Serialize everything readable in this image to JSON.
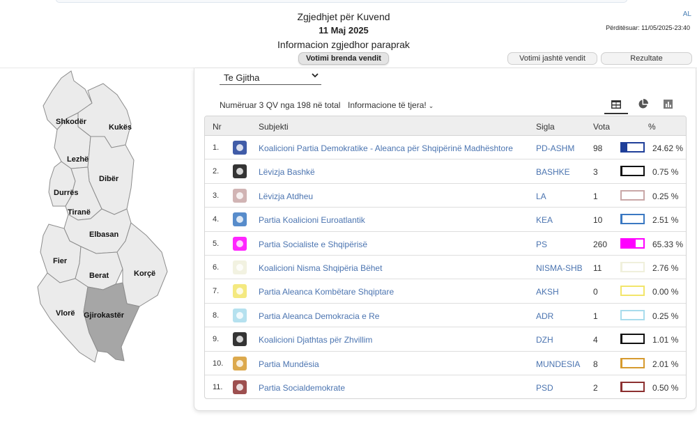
{
  "header": {
    "title": "Zgjedhjet për Kuvend",
    "date": "11 Maj 2025",
    "subtitle": "Informacion zgjedhor paraprak",
    "language": "AL",
    "updated": "Përditësuar: 11/05/2025-23:40"
  },
  "tabs": {
    "domestic": "Votimi brenda vendit",
    "abroad": "Votimi jashtë vendit",
    "results": "Rezultate"
  },
  "map": {
    "regions": [
      "Shkodër",
      "Kukës",
      "Lezhë",
      "Dibër",
      "Durrës",
      "Tiranë",
      "Elbasan",
      "Fier",
      "Berat",
      "Korçë",
      "Vlorë",
      "Gjirokastër"
    ],
    "selected": "Gjirokastër",
    "colors": {
      "default": "#ebebeb",
      "selected": "#a6a6a6",
      "border": "#8c8c8c"
    }
  },
  "filter": {
    "selected": "Te Gjitha"
  },
  "summary": {
    "counted": "Numëruar 3 QV nga 198 në total",
    "more_info": "Informacione të tjera!"
  },
  "views": [
    "table-icon",
    "pie-chart-icon",
    "bar-chart-icon"
  ],
  "table": {
    "headers": {
      "nr": "Nr",
      "subject": "Subjekti",
      "abbr": "Sigla",
      "votes": "Vota",
      "pct": "%"
    },
    "rows": [
      {
        "nr": "1.",
        "name": "Koalicioni Partia Demokratike - Aleanca për Shqipërinë Madhështore",
        "abbr": "PD-ASHM",
        "votes": "98",
        "pct": "24.62 %",
        "share": 0.2462,
        "color": "#1f3f99",
        "logo": "pd-logo-icon"
      },
      {
        "nr": "2.",
        "name": "Lëvizja Bashkë",
        "abbr": "BASHKE",
        "votes": "3",
        "pct": "0.75 %",
        "share": 0.0075,
        "color": "#111111",
        "logo": "bashke-logo-icon"
      },
      {
        "nr": "3.",
        "name": "Lëvizja Atdheu",
        "abbr": "LA",
        "votes": "1",
        "pct": "0.25 %",
        "share": 0.0025,
        "color": "#c9a7a7",
        "logo": "la-logo-icon"
      },
      {
        "nr": "4.",
        "name": "Partia Koalicioni Euroatlantik",
        "abbr": "KEA",
        "votes": "10",
        "pct": "2.51 %",
        "share": 0.0251,
        "color": "#3a78c2",
        "logo": "kea-logo-icon"
      },
      {
        "nr": "5.",
        "name": "Partia Socialiste e Shqipërisë",
        "abbr": "PS",
        "votes": "260",
        "pct": "65.33 %",
        "share": 0.6533,
        "color": "#ff00ff",
        "logo": "ps-logo-icon"
      },
      {
        "nr": "6.",
        "name": "Koalicioni Nisma Shqipëria Bëhet",
        "abbr": "NISMA-SHB",
        "votes": "11",
        "pct": "2.76 %",
        "share": 0.0276,
        "color": "#f0f0dc",
        "logo": "nisma-logo-icon"
      },
      {
        "nr": "7.",
        "name": "Partia Aleanca Kombëtare Shqiptare",
        "abbr": "AKSH",
        "votes": "0",
        "pct": "0.00 %",
        "share": 0.0,
        "color": "#f2e56a",
        "logo": "aksh-logo-icon"
      },
      {
        "nr": "8.",
        "name": "Partia Aleanca Demokracia e Re",
        "abbr": "ADR",
        "votes": "1",
        "pct": "0.25 %",
        "share": 0.0025,
        "color": "#a8dcec",
        "logo": "adr-logo-icon"
      },
      {
        "nr": "9.",
        "name": "Koalicioni Djathtas për Zhvillim",
        "abbr": "DZH",
        "votes": "4",
        "pct": "1.01 %",
        "share": 0.0101,
        "color": "#111111",
        "logo": "dzh-logo-icon"
      },
      {
        "nr": "10.",
        "name": "Partia Mundësia",
        "abbr": "MUNDESIA",
        "votes": "8",
        "pct": "2.01 %",
        "share": 0.0201,
        "color": "#d69a2e",
        "logo": "mundesia-logo-icon"
      },
      {
        "nr": "11.",
        "name": "Partia Socialdemokrate",
        "abbr": "PSD",
        "votes": "2",
        "pct": "0.50 %",
        "share": 0.005,
        "color": "#8c3030",
        "logo": "psd-logo-icon"
      }
    ]
  }
}
